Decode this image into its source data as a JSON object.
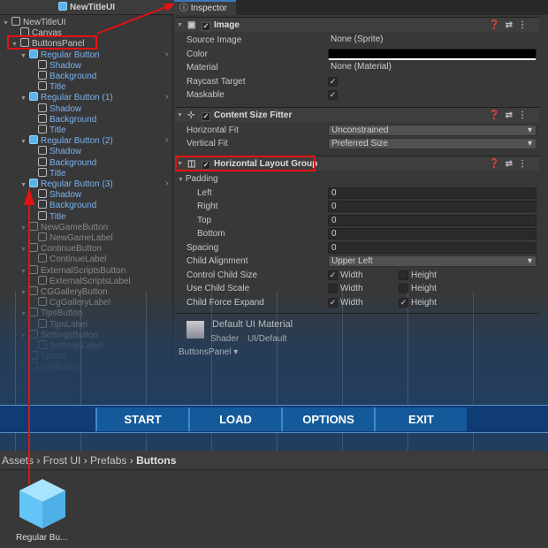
{
  "hierarchy": {
    "title": "NewTitleUI",
    "items": [
      {
        "label": "NewTitleUI",
        "depth": 0,
        "fold": true,
        "prefab": false
      },
      {
        "label": "Canvas",
        "depth": 1,
        "fold": false,
        "prefab": false
      },
      {
        "label": "ButtonsPanel",
        "depth": 1,
        "fold": true,
        "prefab": false
      },
      {
        "label": "Regular Button",
        "depth": 2,
        "fold": true,
        "prefab": true,
        "root": true
      },
      {
        "label": "Shadow",
        "depth": 3,
        "prefab": true
      },
      {
        "label": "Background",
        "depth": 3,
        "prefab": true
      },
      {
        "label": "Title",
        "depth": 3,
        "prefab": true
      },
      {
        "label": "Regular Button (1)",
        "depth": 2,
        "fold": true,
        "prefab": true,
        "root": true
      },
      {
        "label": "Shadow",
        "depth": 3,
        "prefab": true
      },
      {
        "label": "Background",
        "depth": 3,
        "prefab": true
      },
      {
        "label": "Title",
        "depth": 3,
        "prefab": true
      },
      {
        "label": "Regular Button (2)",
        "depth": 2,
        "fold": true,
        "prefab": true,
        "root": true
      },
      {
        "label": "Shadow",
        "depth": 3,
        "prefab": true
      },
      {
        "label": "Background",
        "depth": 3,
        "prefab": true
      },
      {
        "label": "Title",
        "depth": 3,
        "prefab": true
      },
      {
        "label": "Regular Button (3)",
        "depth": 2,
        "fold": true,
        "prefab": true,
        "root": true
      },
      {
        "label": "Shadow",
        "depth": 3,
        "prefab": true
      },
      {
        "label": "Background",
        "depth": 3,
        "prefab": true
      },
      {
        "label": "Title",
        "depth": 3,
        "prefab": true
      },
      {
        "label": "NewGameButton",
        "depth": 2,
        "fold": true,
        "dim": true
      },
      {
        "label": "NewGameLabel",
        "depth": 3,
        "dim": true
      },
      {
        "label": "ContinueButton",
        "depth": 2,
        "fold": true,
        "dim": true
      },
      {
        "label": "ContinueLabel",
        "depth": 3,
        "dim": true
      },
      {
        "label": "ExternalScriptsButton",
        "depth": 2,
        "fold": true,
        "dim": true
      },
      {
        "label": "ExternalScriptsLabel",
        "depth": 3,
        "dim": true
      },
      {
        "label": "CGGalleryButton",
        "depth": 2,
        "fold": true,
        "dim": true
      },
      {
        "label": "CgGalleryLabel",
        "depth": 3,
        "dim": true
      },
      {
        "label": "TipsButton",
        "depth": 2,
        "fold": true,
        "dim": true
      },
      {
        "label": "TipsLabel",
        "depth": 3,
        "dim": true
      },
      {
        "label": "SettingsButton",
        "depth": 2,
        "fold": true,
        "dim": true
      },
      {
        "label": "SettingsLabel",
        "depth": 3,
        "dim": true
      },
      {
        "label": "Space",
        "depth": 2,
        "dim": true
      },
      {
        "label": "ExitButton",
        "depth": 2,
        "fold": true,
        "dim": true
      }
    ]
  },
  "inspector": {
    "tab": "Inspector",
    "image": {
      "title": "Image",
      "source_image_label": "Source Image",
      "source_image": "None (Sprite)",
      "color_label": "Color",
      "color": "#000000",
      "material_label": "Material",
      "material": "None (Material)",
      "raycast_label": "Raycast Target",
      "maskable_label": "Maskable"
    },
    "csf": {
      "title": "Content Size Fitter",
      "hfit_label": "Horizontal Fit",
      "hfit": "Unconstrained",
      "vfit_label": "Vertical Fit",
      "vfit": "Preferred Size"
    },
    "hlg": {
      "title": "Horizontal Layout Group",
      "padding_label": "Padding",
      "left_label": "Left",
      "left": "0",
      "right_label": "Right",
      "right": "0",
      "top_label": "Top",
      "top": "0",
      "bottom_label": "Bottom",
      "bottom": "0",
      "spacing_label": "Spacing",
      "spacing": "0",
      "align_label": "Child Alignment",
      "align": "Upper Left",
      "ccs_label": "Control Child Size",
      "ucs_label": "Use Child Scale",
      "cfe_label": "Child Force Expand",
      "width": "Width",
      "height": "Height"
    },
    "material": {
      "title": "Default UI Material",
      "shader_label": "Shader",
      "shader": "UI/Default"
    },
    "footer": "ButtonsPanel"
  },
  "game_buttons": [
    "START",
    "LOAD",
    "OPTIONS",
    "EXIT"
  ],
  "project": {
    "crumbs": [
      "Assets",
      "Frost UI",
      "Prefabs"
    ],
    "current": "Buttons",
    "asset": "Regular Bu..."
  },
  "annotation_color": "#e41212"
}
